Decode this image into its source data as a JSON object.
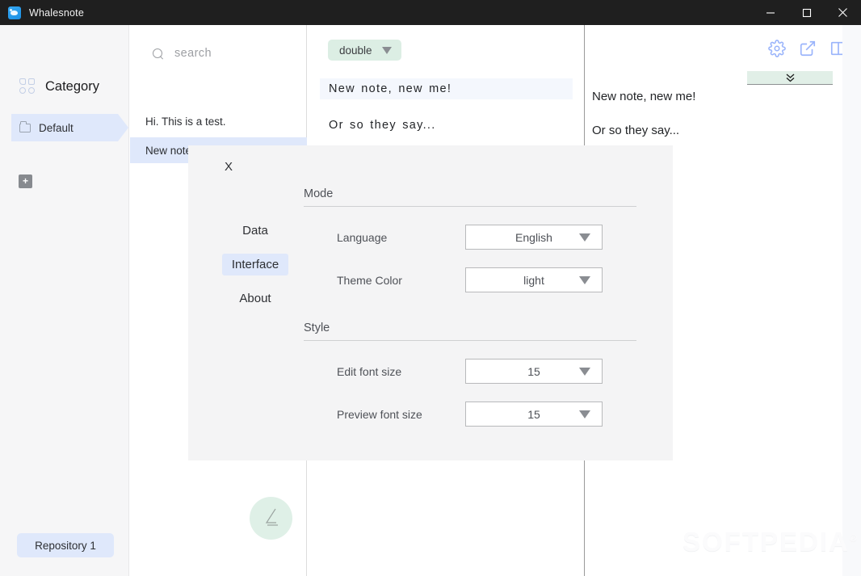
{
  "window": {
    "title": "Whalesnote",
    "app_icon": "whale-app-icon",
    "controls": {
      "minimize": "minimize-icon",
      "maximize": "maximize-icon",
      "close": "close-icon"
    }
  },
  "sidebar": {
    "category_icon": "grid-category-icon",
    "category_title": "Category",
    "items": [
      {
        "label": "Default",
        "icon": "folder-icon",
        "selected": true
      }
    ],
    "add_button_label": "+",
    "repository_button": "Repository 1"
  },
  "notelist": {
    "search": {
      "placeholder": "search",
      "value": "",
      "icon": "search-icon"
    },
    "notes": [
      {
        "title": "Hi. This is a test.",
        "selected": false
      },
      {
        "title": "New note, new me!",
        "selected": true
      }
    ]
  },
  "editor": {
    "mode_chip": {
      "label": "double",
      "icon": "chevron-down-icon"
    },
    "lines": [
      "New  note,  new  me!",
      "Or  so  they  say..."
    ],
    "new_note_fab": "pen-icon"
  },
  "preview": {
    "toolbar": [
      {
        "name": "settings-gear-icon",
        "label": "gear-icon"
      },
      {
        "name": "open-external-icon",
        "label": "external-link-icon"
      },
      {
        "name": "split-view-icon",
        "label": "split-view-icon"
      }
    ],
    "collapse_bar_icon": "double-chevron-down-icon",
    "lines": [
      "New note, new me!",
      "Or so they say..."
    ]
  },
  "watermark": {
    "text": "SOFTPEDIA",
    "mark": "®"
  },
  "settings_modal": {
    "close_label": "X",
    "nav": [
      {
        "label": "Data",
        "active": false
      },
      {
        "label": "Interface",
        "active": true
      },
      {
        "label": "About",
        "active": false
      }
    ],
    "sections": [
      {
        "title": "Mode",
        "fields": [
          {
            "label": "Language",
            "value": "English",
            "icon": "chevron-down-icon"
          },
          {
            "label": "Theme Color",
            "value": "light",
            "icon": "chevron-down-icon"
          }
        ]
      },
      {
        "title": "Style",
        "fields": [
          {
            "label": "Edit font size",
            "value": "15",
            "icon": "chevron-down-icon"
          },
          {
            "label": "Preview font size",
            "value": "15",
            "icon": "chevron-down-icon"
          }
        ]
      }
    ]
  },
  "colors": {
    "titlebar_bg": "#1f1f1f",
    "accent_blue": "#dfe8fb",
    "accent_green": "#dceee4",
    "toolbar_icon": "#9ab4fb",
    "modal_bg": "#f4f4f5"
  }
}
